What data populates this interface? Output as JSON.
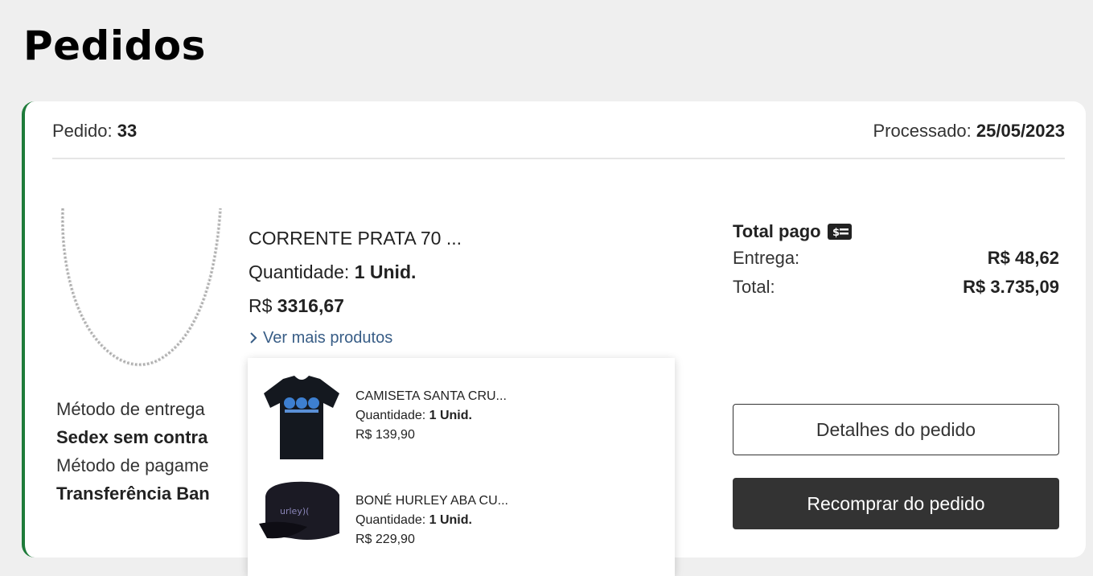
{
  "page": {
    "title": "Pedidos"
  },
  "order": {
    "id_label": "Pedido: ",
    "id": "33",
    "processed_label": "Processado: ",
    "processed_date": "25/05/2023",
    "product": {
      "image_icon": "silver-chain-necklace-image",
      "name": "CORRENTE PRATA 70 ...",
      "qty_label": "Quantidade: ",
      "qty": "1 Unid.",
      "price_prefix": "R$ ",
      "price": "3316,67"
    },
    "see_more": "Ver mais produtos",
    "delivery_label": "Método de entrega",
    "delivery_value": "Sedex sem contra",
    "payment_label": "Método de pagame",
    "payment_value": "Transferência Ban",
    "totals": {
      "title": "Total pago",
      "icon": "cash-icon",
      "shipping_label": "Entrega:",
      "shipping_value": "R$ 48,62",
      "total_label": "Total:",
      "total_value": "R$ 3.735,09"
    },
    "buttons": {
      "details": "Detalhes do pedido",
      "rebuy": "Recomprar do pedido"
    }
  },
  "popover": {
    "items": [
      {
        "name": "CAMISETA SANTA CRU...",
        "qty_label": "Quantidade: ",
        "qty": "1 Unid.",
        "price": "R$ 139,90"
      },
      {
        "name": "BONÉ HURLEY ABA CU...",
        "qty_label": "Quantidade: ",
        "qty": "1 Unid.",
        "price": "R$ 229,90"
      }
    ]
  },
  "colors": {
    "accent_border": "#1e7b3a",
    "link": "#385d86",
    "dark_button": "#333333"
  }
}
